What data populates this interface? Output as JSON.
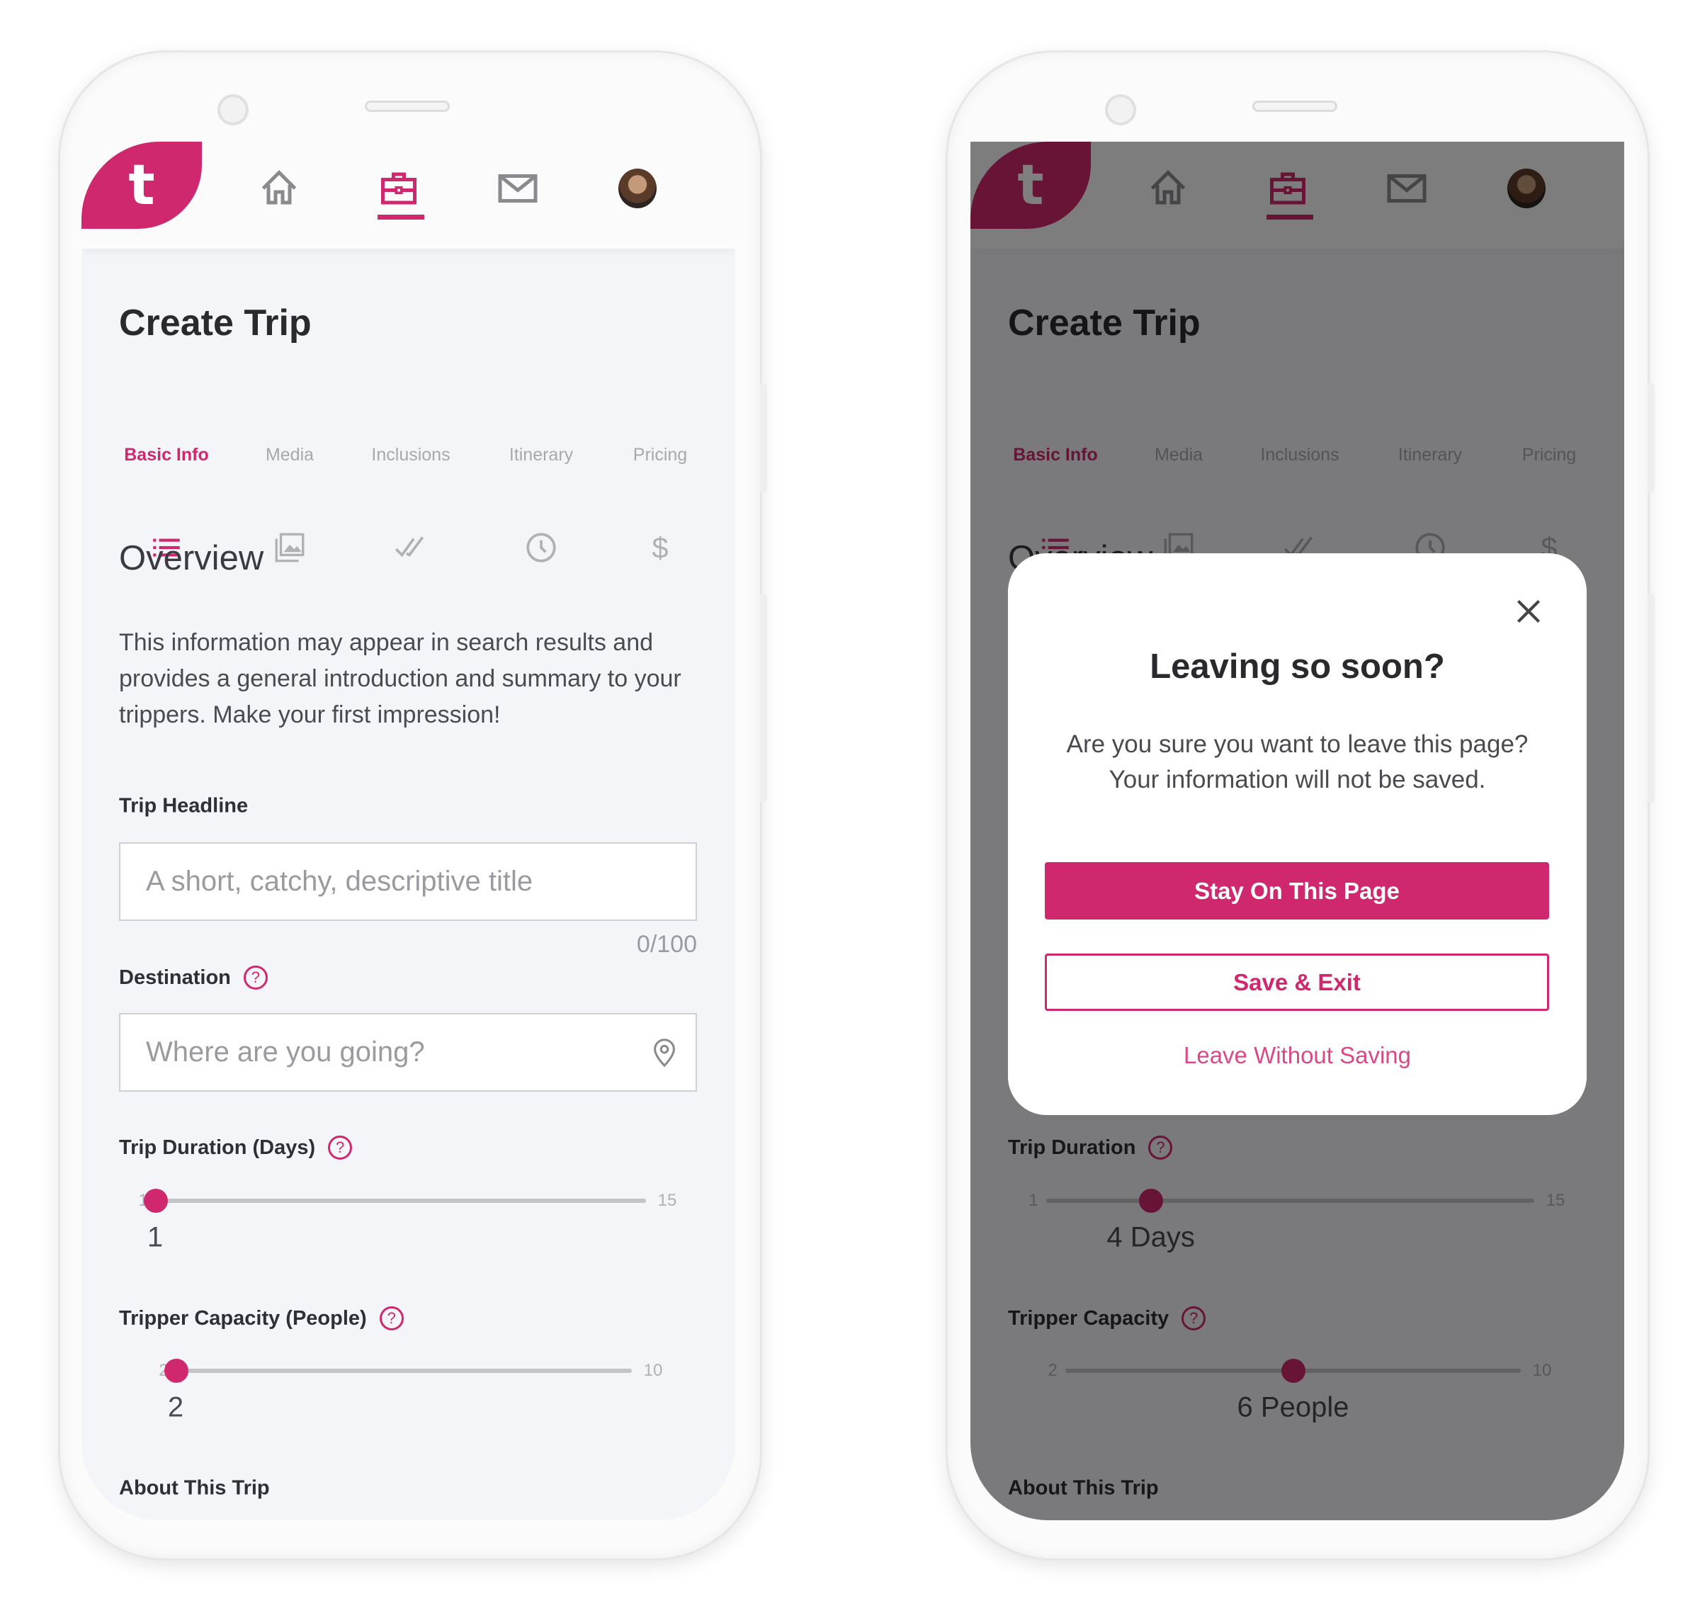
{
  "colors": {
    "accent": "#d0286f",
    "background": "#f4f5f8",
    "muted": "#a8a8ad"
  },
  "left_screen": {
    "logo": "t",
    "nav": [
      {
        "icon": "home-icon"
      },
      {
        "icon": "briefcase-icon",
        "active": true
      },
      {
        "icon": "mail-icon"
      },
      {
        "icon": "avatar"
      }
    ],
    "title": "Create Trip",
    "tabs": [
      {
        "label": "Basic Info",
        "icon": "list-icon",
        "active": true
      },
      {
        "label": "Media",
        "icon": "gallery-icon"
      },
      {
        "label": "Inclusions",
        "icon": "double-check-icon"
      },
      {
        "label": "Itinerary",
        "icon": "clock-icon"
      },
      {
        "label": "Pricing",
        "icon": "dollar-icon"
      }
    ],
    "overview_heading": "Overview",
    "overview_text": "This information may appear in search results and provides a general introduction and summary to your trippers. Make your first impression!",
    "headline": {
      "label": "Trip Headline",
      "placeholder": "A short, catchy, descriptive title",
      "counter": "0/100"
    },
    "destination": {
      "label": "Destination",
      "placeholder": "Where are you going?"
    },
    "duration": {
      "label": "Trip Duration (Days)",
      "min": 1,
      "max": 15,
      "value": 1,
      "min_label": "1",
      "max_label": "15",
      "value_label": "1"
    },
    "capacity": {
      "label": "Tripper Capacity (People)",
      "min": 2,
      "max": 10,
      "value": 2,
      "min_label": "2",
      "max_label": "10",
      "value_label": "2"
    },
    "about": "About This Trip"
  },
  "right_screen": {
    "logo": "t",
    "title": "Create Trip",
    "tabs": [
      {
        "label": "Basic Info",
        "icon": "list-icon",
        "active": true
      },
      {
        "label": "Media",
        "icon": "gallery-icon"
      },
      {
        "label": "Inclusions",
        "icon": "double-check-icon"
      },
      {
        "label": "Itinerary",
        "icon": "clock-icon"
      },
      {
        "label": "Pricing",
        "icon": "dollar-icon"
      }
    ],
    "overview_heading": "Overview",
    "duration": {
      "label": "Trip Duration",
      "min": 1,
      "max": 15,
      "value": 4,
      "min_label": "1",
      "max_label": "15",
      "value_label": "4 Days"
    },
    "capacity": {
      "label": "Tripper Capacity",
      "min": 2,
      "max": 10,
      "value": 6,
      "min_label": "2",
      "max_label": "10",
      "value_label": "6 People"
    },
    "about": "About This Trip",
    "modal": {
      "title": "Leaving so soon?",
      "body_line1": "Are you sure you want to leave this page?",
      "body_line2": "Your information will not be saved.",
      "stay_label": "Stay On This Page",
      "save_label": "Save & Exit",
      "leave_label": "Leave Without Saving"
    }
  }
}
